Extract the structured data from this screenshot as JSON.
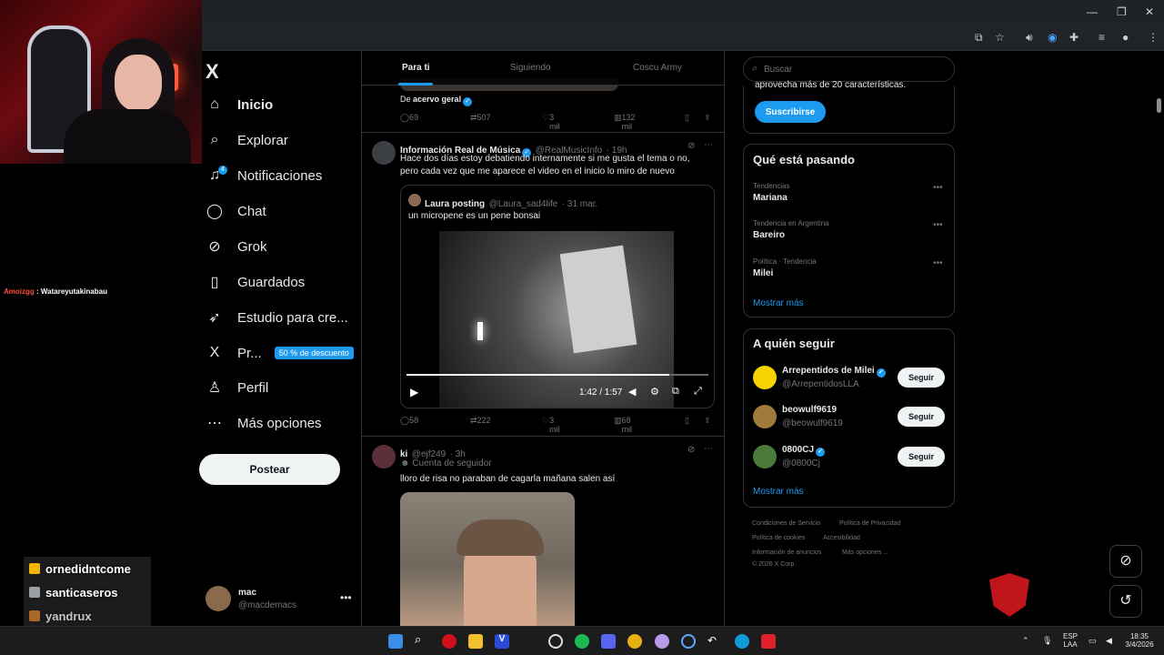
{
  "browser": {
    "min": "—",
    "restore": "❐",
    "close": "✕"
  },
  "stream": {
    "chat_user": "Amoizgg",
    "chat_message": ": Watareyutakinabau",
    "subs": [
      {
        "name": "ornedidntcome",
        "color": "#f2b705"
      },
      {
        "name": "santicaseros",
        "color": "#9aa0a6"
      },
      {
        "name": "yandrux",
        "color": "#d9822b"
      }
    ]
  },
  "nav": {
    "logo": "X",
    "items": [
      {
        "label": "Inicio",
        "icon": "⌂"
      },
      {
        "label": "Explorar",
        "icon": "⌕"
      },
      {
        "label": "Notificaciones",
        "icon": "♫"
      },
      {
        "label": "Chat",
        "icon": "◯"
      },
      {
        "label": "Grok",
        "icon": "⊘"
      },
      {
        "label": "Guardados",
        "icon": "▯"
      },
      {
        "label": "Estudio para cre...",
        "icon": "➶"
      },
      {
        "label": "Pr...",
        "icon": "X"
      },
      {
        "label": "Perfil",
        "icon": "♙"
      },
      {
        "label": "Más opciones",
        "icon": "⋯"
      }
    ],
    "notif_count": "4",
    "promo": "50 % de descuento",
    "post_button": "Postear",
    "account": {
      "name": "mac",
      "handle": "@macdemacs"
    }
  },
  "feed": {
    "tabs": [
      "Para ti",
      "Siguiendo",
      "Coscu Army"
    ],
    "tweet0": {
      "from_label": "De",
      "from_name": "acervo geral",
      "stats": {
        "replies": "69",
        "retweets": "507",
        "likes": "3 mil",
        "views": "132 mil"
      }
    },
    "tweet1": {
      "name": "Información Real de Música",
      "handle": "@RealMusicInfo",
      "time": "· 19h",
      "text": "Hace dos días estoy debatiendo internamente si me gusta el tema o no, pero cada vez que me aparece el video en el inicio lo miro de nuevo",
      "quote": {
        "name": "Laura posting",
        "handle": "@Laura_sad4life",
        "time": "· 31 mar.",
        "text": "un micropene es un pene bonsai"
      },
      "video_time": "1:42 / 1:57",
      "video_progress": 0.87,
      "stats": {
        "replies": "58",
        "retweets": "222",
        "likes": "3 mil",
        "views": "68 mil"
      }
    },
    "tweet2": {
      "name": "ki",
      "handle": "@ejf249",
      "time": "· 3h",
      "badge": "Cuenta de seguidor",
      "text": "lloro de risa no paraban de cagarla mañana salen así"
    }
  },
  "right": {
    "search_placeholder": "Buscar",
    "premium_text": "aprovecha más de 20 características.",
    "subscribe": "Suscribirse",
    "trends_title": "Qué está pasando",
    "trends": [
      {
        "category": "Tendencias",
        "name": "Mariana"
      },
      {
        "category": "Tendencia en Argentina",
        "name": "Bareiro"
      },
      {
        "category": "Política · Tendencia",
        "name": "Milei"
      }
    ],
    "show_more": "Mostrar más",
    "follow_title": "A quién seguir",
    "follow": [
      {
        "name": "Arrepentidos de Milei",
        "handle": "@ArrepentidosLLA",
        "color": "#f6d200"
      },
      {
        "name": "beowulf9619",
        "handle": "@beowulf9619",
        "color": "#a07a3a"
      },
      {
        "name": "0800CJ",
        "handle": "@0800Cj",
        "color": "#4a7a3a"
      }
    ],
    "follow_button": "Seguir",
    "footer": [
      "Condiciones de Servicio",
      "Política de Privacidad",
      "Política de cookies",
      "Accesibilidad",
      "Información de anuncios",
      "Más opciones ...",
      "© 2026 X Corp."
    ]
  },
  "taskbar": {
    "lang1": "ESP",
    "lang2": "LAA",
    "time": "18:35",
    "date": "3/4/2026"
  }
}
